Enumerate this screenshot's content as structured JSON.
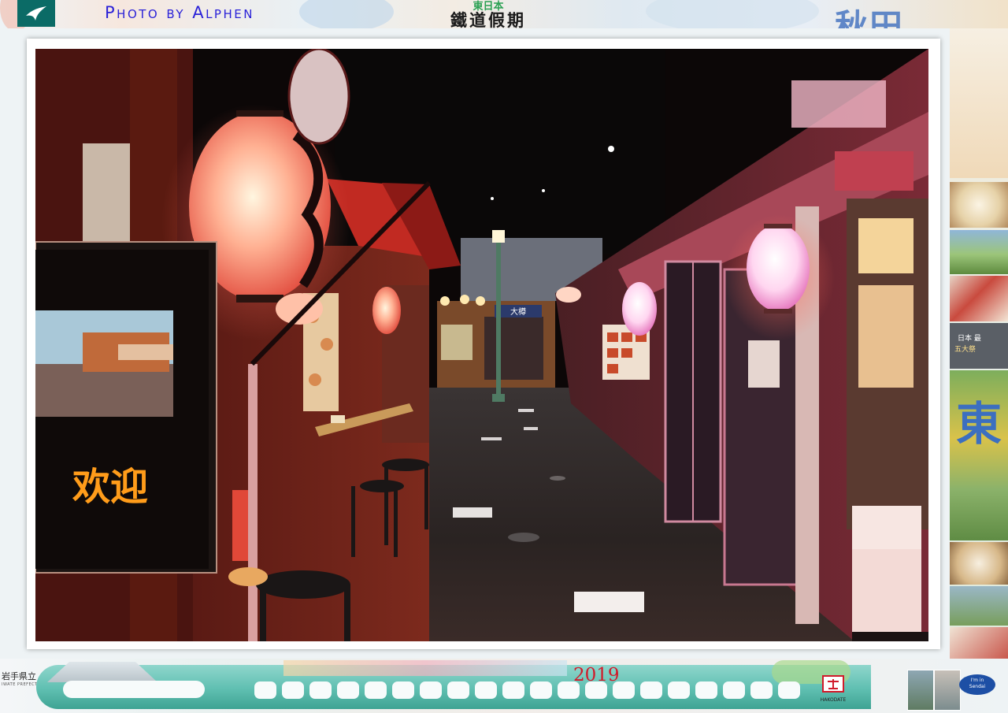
{
  "banner": {
    "photo_credit": "Photo by Alphen",
    "rail_brand_top": "東日本",
    "rail_brand_main": "鐵道假期",
    "akita_text": "秋田",
    "airline_logo_icon": "crane-logo-icon"
  },
  "side_strip": {
    "tohoku_char": "東",
    "tag_text": "日本 最",
    "tag_text_2": "五大祭"
  },
  "photo": {
    "led_sign_text": "欢迎",
    "shop_sign_text": "大樽"
  },
  "footer": {
    "prefecture_label": "岩手県立",
    "prefecture_sub": "IWATE PREFECTURAL",
    "year": "2019",
    "hakodate_label": "HAKODATE",
    "hakodate_icon": "hakodate-mascot-icon",
    "sendai_badge_line1": "I'm in",
    "sendai_badge_line2": "Sendai"
  },
  "colors": {
    "credit": "#2b22d8",
    "year": "#d11a2a",
    "train": "#5fbfb1",
    "frame": "#ffffff"
  }
}
